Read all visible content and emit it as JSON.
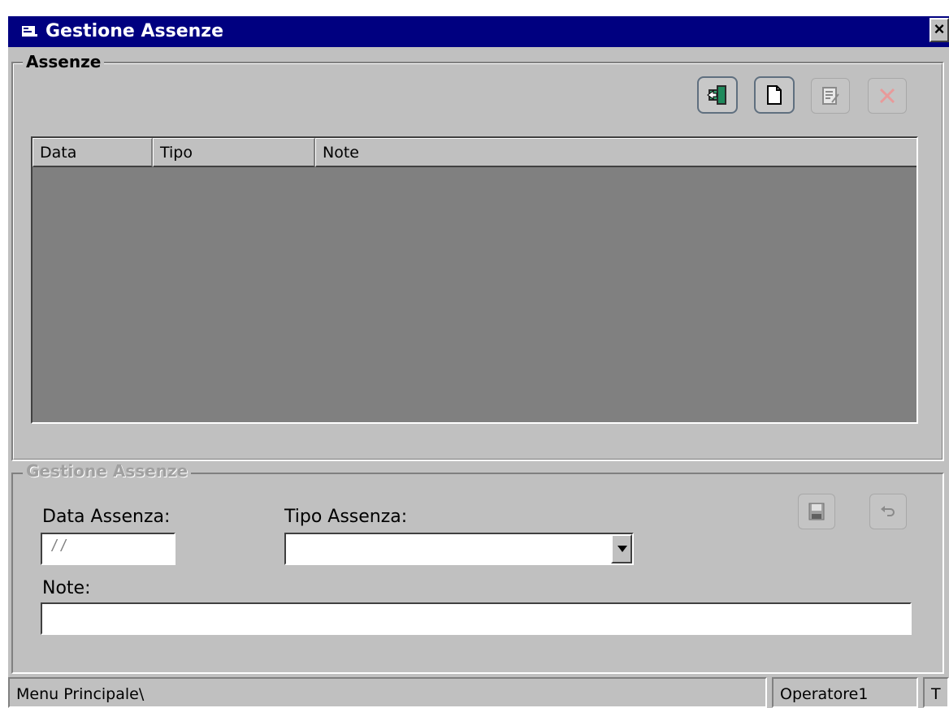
{
  "window": {
    "title": "Gestione Assenze",
    "close_label": "×"
  },
  "assenze_group": {
    "legend": "Assenze",
    "toolbar": {
      "exit_icon": "exit-door-icon",
      "new_icon": "new-document-icon",
      "edit_icon": "edit-document-icon",
      "delete_icon": "delete-x-icon"
    },
    "grid": {
      "columns": [
        "Data",
        "Tipo",
        "Note"
      ],
      "rows": []
    }
  },
  "gestione_group": {
    "legend": "Gestione Assenze",
    "data_assenza_label": "Data Assenza:",
    "data_assenza_value": "/ /",
    "tipo_assenza_label": "Tipo Assenza:",
    "tipo_assenza_value": "",
    "note_label": "Note:",
    "note_value": "",
    "save_icon": "floppy-disk-icon",
    "undo_icon": "undo-arrow-icon"
  },
  "statusbar": {
    "path": "Menu Principale\\",
    "operator": "Operatore1",
    "extra": "T"
  },
  "colors": {
    "titlebar": "#000080",
    "face": "#c0c0c0",
    "grid_bg": "#808080"
  }
}
